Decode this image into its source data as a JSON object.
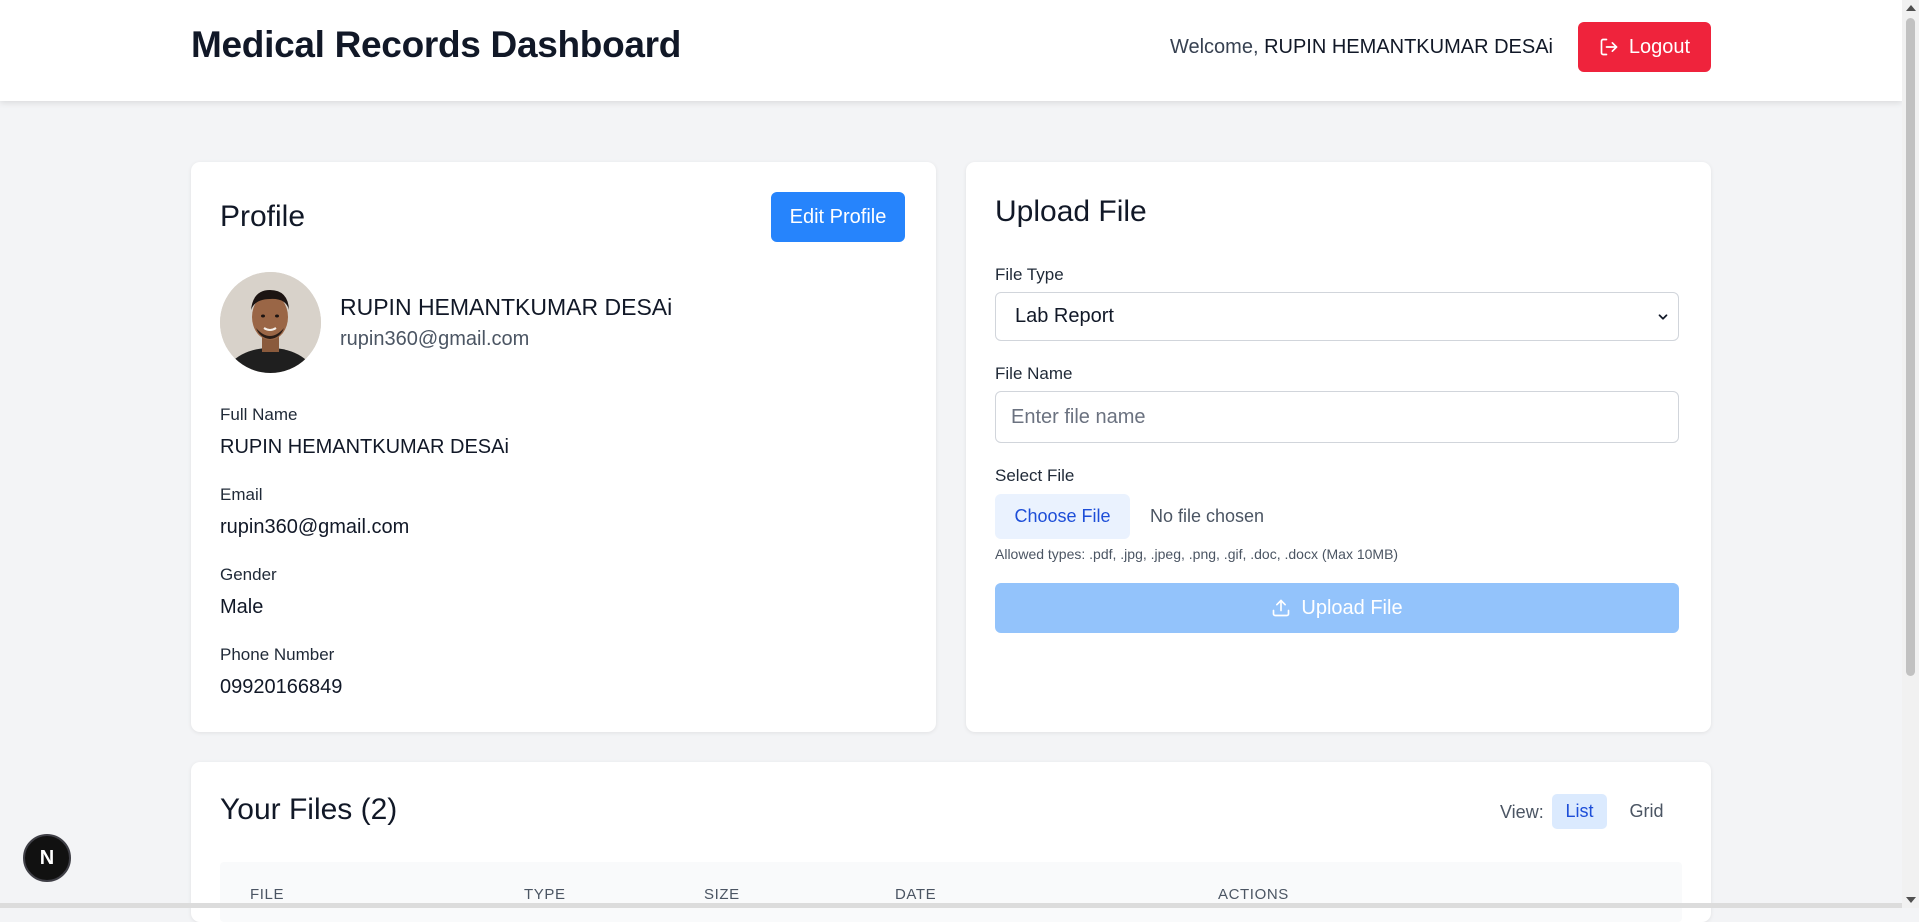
{
  "header": {
    "title": "Medical Records Dashboard",
    "welcome_prefix": "Welcome,",
    "user_name": "RUPIN HEMANTKUMAR DESAi",
    "logout_label": "Logout"
  },
  "profile": {
    "title": "Profile",
    "edit_label": "Edit Profile",
    "name": "RUPIN HEMANTKUMAR DESAi",
    "email": "rupin360@gmail.com",
    "fields": [
      {
        "label": "Full Name",
        "value": "RUPIN HEMANTKUMAR DESAi"
      },
      {
        "label": "Email",
        "value": "rupin360@gmail.com"
      },
      {
        "label": "Gender",
        "value": "Male"
      },
      {
        "label": "Phone Number",
        "value": "09920166849"
      }
    ]
  },
  "upload": {
    "title": "Upload File",
    "file_type_label": "File Type",
    "file_type_value": "Lab Report",
    "file_name_label": "File Name",
    "file_name_placeholder": "Enter file name",
    "file_name_value": "",
    "select_file_label": "Select File",
    "choose_label": "Choose File",
    "no_file_text": "No file chosen",
    "hint": "Allowed types: .pdf, .jpg, .jpeg, .png, .gif, .doc, .docx (Max 10MB)",
    "submit_label": "Upload File"
  },
  "files": {
    "title": "Your Files (2)",
    "view_label": "View:",
    "view_options": [
      "List",
      "Grid"
    ],
    "view_selected": "List",
    "columns": [
      "FILE",
      "TYPE",
      "SIZE",
      "DATE",
      "ACTIONS"
    ]
  },
  "badge": {
    "letter": "N"
  },
  "colors": {
    "logout": "#ef233c",
    "primary": "#2684fc",
    "upload_disabled": "#93c3fb",
    "background": "#f3f4f6"
  }
}
